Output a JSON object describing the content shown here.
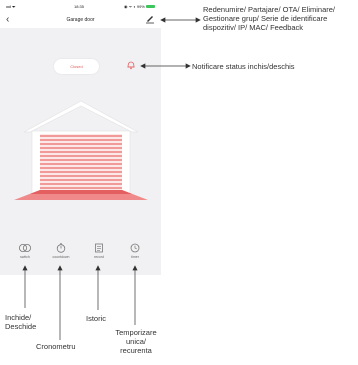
{
  "status_bar": {
    "signal": "•ııl ᯤ",
    "time": "18:35",
    "right": "◉ ᯤ ◐ 99%"
  },
  "nav": {
    "back": "‹",
    "title": "Garage door"
  },
  "door": {
    "status": "Closed"
  },
  "controls": [
    {
      "label": "switch",
      "icon": "toggle-icon"
    },
    {
      "label": "countdown",
      "icon": "stopwatch-icon"
    },
    {
      "label": "record",
      "icon": "record-icon"
    },
    {
      "label": "timer",
      "icon": "clock-icon"
    }
  ],
  "annotations": {
    "edit_menu": "Redenumire/ Partajare/ OTA/ Eliminare/ Gestionare grup/ Serie de identificare dispozitiv/ IP/ MAC/ Feedback",
    "notification": "Notificare status inchis/deschis",
    "switch": "Inchide/ Deschide",
    "countdown": "Cronometru",
    "record": "Istoric",
    "timer": "Temporizare unica/ recurenta"
  },
  "colors": {
    "accent": "#e35c5c",
    "background": "#f1f1f3"
  }
}
